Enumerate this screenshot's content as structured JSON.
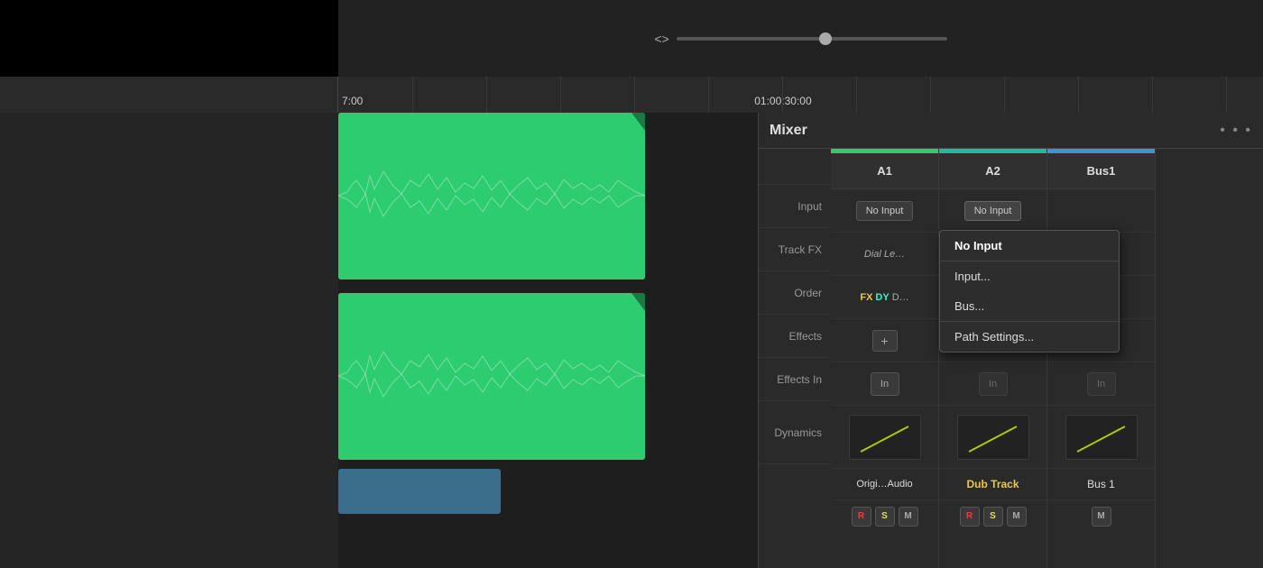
{
  "topbar": {
    "scrubber_icon": "<>"
  },
  "timeline": {
    "time_left": "7:00",
    "time_right": "01:00:30:00"
  },
  "mixer": {
    "title": "Mixer",
    "menu_dots": "• • •",
    "row_labels": {
      "input": "Input",
      "track_fx": "Track FX",
      "order": "Order",
      "effects": "Effects",
      "effects_in": "Effects In",
      "dynamics": "Dynamics"
    },
    "channels": [
      {
        "id": "a1",
        "name": "A1",
        "accent_color": "#2ecc71",
        "input": "No Input",
        "track_fx": "Dial Le…",
        "order_fx": "FX",
        "order_dy": "DY",
        "order_extra": "D…",
        "bottom_label": "Origi…Audio",
        "bottom_label_color": "#ddd"
      },
      {
        "id": "a2",
        "name": "A2",
        "accent_color": "#1abc9c",
        "input": "No Input",
        "track_fx": "",
        "order_fx": "",
        "order_dy": "",
        "order_extra": "",
        "bottom_label": "Dub Track",
        "bottom_label_color": "#e8c84a"
      },
      {
        "id": "bus1",
        "name": "Bus1",
        "accent_color": "#3498db",
        "input": "",
        "track_fx": "",
        "order_fx": "",
        "order_dy": "",
        "order_extra": "",
        "bottom_label": "Bus 1",
        "bottom_label_color": "#ddd"
      }
    ],
    "dropdown": {
      "items": [
        {
          "label": "No Input",
          "type": "selected"
        },
        {
          "label": "Input...",
          "type": "normal"
        },
        {
          "label": "Bus...",
          "type": "normal"
        },
        {
          "label": "Path Settings...",
          "type": "normal"
        }
      ]
    }
  }
}
